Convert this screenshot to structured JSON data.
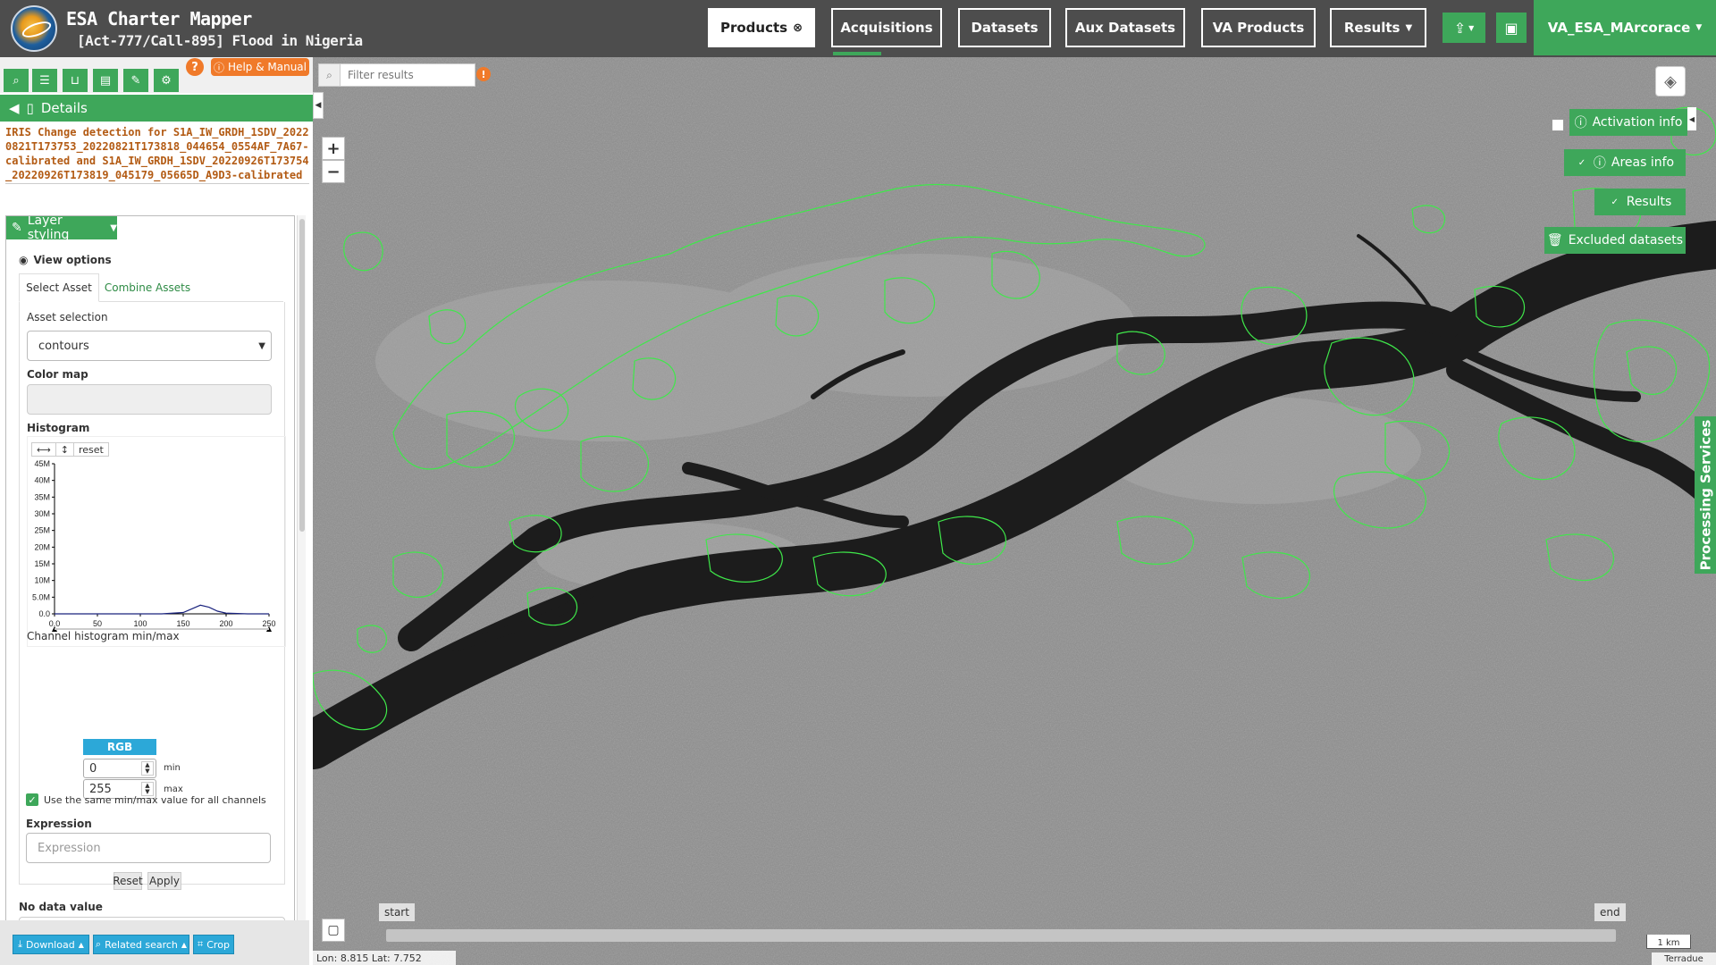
{
  "header": {
    "app_title": "ESA Charter Mapper",
    "activation": "[Act-777/Call-895] Flood in Nigeria",
    "nav": [
      "Products",
      "Acquisitions",
      "Datasets",
      "Aux Datasets",
      "VA Products",
      "Results"
    ],
    "user": "VA_ESA_MArcorace"
  },
  "panel": {
    "help_label": "Help & Manual",
    "details_label": "Details",
    "product_title": "IRIS Change detection for S1A_IW_GRDH_1SDV_20220821T173753_20220821T173818_044654_0554AF_7A67-calibrated and S1A_IW_GRDH_1SDV_20220926T173754_20220926T173819_045179_05665D_A9D3-calibrated",
    "layer_styling": "Layer styling",
    "view_options": "View options",
    "tabs": [
      "Select Asset",
      "Combine Assets"
    ],
    "asset_selection_label": "Asset selection",
    "asset_value": "contours",
    "color_map_label": "Color map",
    "histogram_label": "Histogram",
    "hist_reset": "reset",
    "channel_label": "Channel histogram min/max",
    "rgb_label": "RGB",
    "min_value": "0",
    "max_value": "255",
    "min_label": "min",
    "max_label": "max",
    "same_minmax_label": "Use the same min/max value for all channels",
    "expression_label": "Expression",
    "expression_placeholder": "Expression",
    "reset_btn": "Reset",
    "apply_btn": "Apply",
    "nodata_label": "No data value",
    "download_btn": "Download",
    "related_btn": "Related search",
    "crop_btn": "Crop"
  },
  "map": {
    "filter_placeholder": "Filter results",
    "activation_info": "Activation info",
    "areas_info": "Areas info",
    "results": "Results",
    "excluded_datasets": "Excluded datasets",
    "processing_services": "Processing Services",
    "timeline_start": "start",
    "timeline_end": "end",
    "scale": "1 km",
    "attribution": "Terradue",
    "coords": "Lon: 8.815 Lat: 7.752"
  },
  "chart_data": {
    "type": "line",
    "title": "",
    "x": [
      0,
      25,
      50,
      75,
      100,
      125,
      150,
      160,
      170,
      180,
      190,
      200,
      225,
      250
    ],
    "series": [
      {
        "values": [
          0,
          0,
          0,
          0,
          0,
          0,
          0.4,
          1.5,
          2.6,
          2.0,
          0.8,
          0.2,
          0,
          0
        ]
      }
    ],
    "x_ticks": [
      "0.0",
      "50",
      "100",
      "150",
      "200",
      "250"
    ],
    "y_ticks": [
      "0.0",
      "5.0M",
      "10M",
      "15M",
      "20M",
      "25M",
      "30M",
      "35M",
      "40M",
      "45M"
    ],
    "xlim": [
      0,
      250
    ],
    "ylim": [
      0,
      45
    ]
  },
  "colors": {
    "accent": "#3ea75a",
    "help": "#f07a2a",
    "title": "#b35b14",
    "info": "#2ca8d8",
    "hist_line": "#1a237e"
  }
}
